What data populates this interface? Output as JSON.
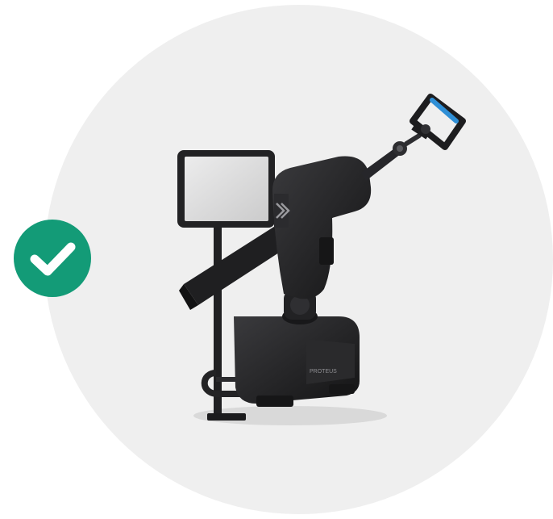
{
  "image": {
    "subject": "strength-training-machine",
    "status_icon": "checkmark-icon",
    "brand_logo_text": "PROTEUS"
  },
  "colors": {
    "background": "#ffffff",
    "circle": "#efefef",
    "badge": "#139b77",
    "check": "#ffffff",
    "machine_body": "#1d1d1f",
    "machine_highlight": "#3a3a3d",
    "screen": "#d8d8d8",
    "handle_accent": "#2f8fd6"
  }
}
